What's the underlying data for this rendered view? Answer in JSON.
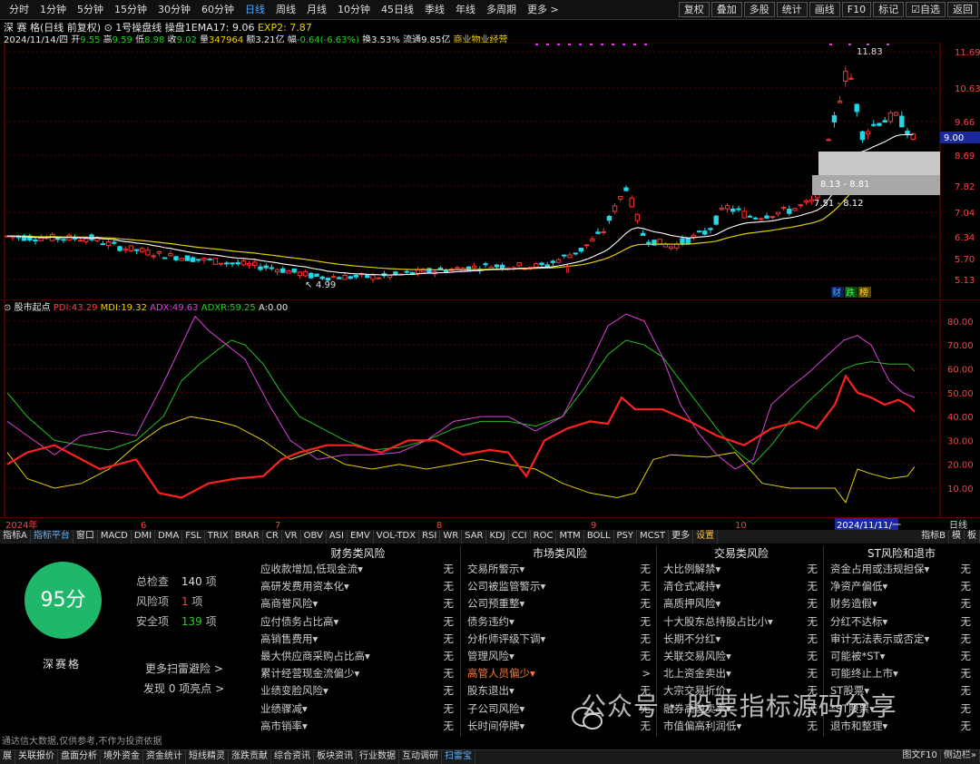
{
  "toolbar": {
    "period_tabs": [
      "分时",
      "1分钟",
      "5分钟",
      "15分钟",
      "30分钟",
      "60分钟",
      "日线",
      "周线",
      "月线",
      "10分钟",
      "45日线",
      "季线",
      "年线",
      "多周期",
      "更多 >"
    ],
    "active_tab": "日线",
    "right_buttons": [
      "复权",
      "叠加",
      "多股",
      "统计",
      "画线",
      "F10",
      "标记",
      "☑自选",
      "返回"
    ]
  },
  "info": {
    "stock_title": "深 赛 格(日线 前复权)",
    "indicator_name": "1号操盘线",
    "ema_label": "操盘1EMA17:",
    "ema_value": "9.06",
    "exp2_label": "EXP2:",
    "exp2_value": "7.87",
    "date": "2024/11/14/四",
    "open_label": "开",
    "open": "9.55",
    "high_label": "高",
    "high": "9.59",
    "low_label": "低",
    "low": "8.98",
    "close_label": "收",
    "close": "9.02",
    "volume_label": "量",
    "volume": "347964",
    "amount_label": "额",
    "amount": "3.21亿",
    "change_label": "幅",
    "change": "-0.64(-6.63%)",
    "turnover_label": "换",
    "turnover": "3.53%",
    "float_label": "流通",
    "float": "9.85亿",
    "sector": "商业物业经营"
  },
  "main_chart": {
    "y_ticks": [
      "11.69",
      "10.63",
      "9.66",
      "8.69",
      "7.82",
      "7.04",
      "6.34",
      "5.70",
      "5.13"
    ],
    "current_price": "9.00",
    "high_mark": "11.83",
    "low_mark": "4.99",
    "zone1_label": "8.13 - 8.81",
    "zone2_label": "7.51 - 8.12",
    "badges": [
      "财",
      "跌",
      "榜"
    ]
  },
  "indicator": {
    "name": "股市起点",
    "pdi_label": "PDI:",
    "pdi": "43.29",
    "mdi_label": "MDI:",
    "mdi": "19.32",
    "adx_label": "ADX:",
    "adx": "49.63",
    "adxr_label": "ADXR:",
    "adxr": "59.25",
    "a_label": "A:",
    "a": "0.00",
    "y_ticks": [
      "80.00",
      "70.00",
      "60.00",
      "50.00",
      "40.00",
      "30.00",
      "20.00",
      "10.00"
    ]
  },
  "date_axis": {
    "labels": [
      "2024年",
      "6",
      "7",
      "8",
      "9",
      "10"
    ],
    "cursor_date": "2024/11/11/一",
    "period": "日线"
  },
  "indicator_tabs": [
    "指标A",
    "指标平台",
    "窗口",
    "MACD",
    "DMI",
    "DMA",
    "FSL",
    "TRIX",
    "BRAR",
    "CR",
    "VR",
    "OBV",
    "ASI",
    "EMV",
    "VOL-TDX",
    "RSI",
    "WR",
    "SAR",
    "KDJ",
    "CCI",
    "ROC",
    "MTM",
    "BOLL",
    "PSY",
    "MCST",
    "更多",
    "设置"
  ],
  "indicator_tabs_right": [
    "指标B",
    "模",
    "板"
  ],
  "risk": {
    "score": "95分",
    "company": "深赛格",
    "total_label": "总检查",
    "total": "140",
    "risk_label": "风险项",
    "risk_count": "1",
    "safe_label": "安全项",
    "safe_count": "139",
    "unit": "项",
    "more": "更多扫雷避险 >",
    "found": "发现 0 项亮点 >",
    "columns": [
      {
        "title": "财务类风险",
        "rows": [
          {
            "name": "应收款增加,低现金流",
            "val": "无"
          },
          {
            "name": "高研发费用资本化",
            "val": "无"
          },
          {
            "name": "高商誉风险",
            "val": "无"
          },
          {
            "name": "应付债务占比高",
            "val": "无"
          },
          {
            "name": "高销售费用",
            "val": "无"
          },
          {
            "name": "最大供应商采购占比高",
            "val": "无"
          },
          {
            "name": "累计经营现金流偏少",
            "val": "无"
          },
          {
            "name": "业绩变脸风险",
            "val": "无"
          },
          {
            "name": "业绩骤减",
            "val": "无"
          },
          {
            "name": "高市销率",
            "val": "无"
          }
        ]
      },
      {
        "title": "市场类风险",
        "rows": [
          {
            "name": "交易所警示",
            "val": "无"
          },
          {
            "name": "公司被监管警示",
            "val": "无"
          },
          {
            "name": "公司预重整",
            "val": "无"
          },
          {
            "name": "债务违约",
            "val": "无"
          },
          {
            "name": "分析师评级下调",
            "val": "无"
          },
          {
            "name": "管理风险",
            "val": "无"
          },
          {
            "name": "高管人员偏少",
            "val": ">",
            "alert": true
          },
          {
            "name": "股东退出",
            "val": "无"
          },
          {
            "name": "子公司风险",
            "val": "无"
          },
          {
            "name": "长时间停牌",
            "val": "无"
          }
        ]
      },
      {
        "title": "交易类风险",
        "rows": [
          {
            "name": "大比例解禁",
            "val": "无"
          },
          {
            "name": "清仓式减持",
            "val": "无"
          },
          {
            "name": "高质押风险",
            "val": "无"
          },
          {
            "name": "十大股东总持股占比小",
            "val": "无"
          },
          {
            "name": "长期不分红",
            "val": "无"
          },
          {
            "name": "关联交易风险",
            "val": "无"
          },
          {
            "name": "北上资金卖出",
            "val": "无"
          },
          {
            "name": "大宗交易折价",
            "val": "无"
          },
          {
            "name": "融券高融卖率",
            "val": "无"
          },
          {
            "name": "市值偏高利润低",
            "val": "无"
          }
        ]
      },
      {
        "title": "ST风险和退市",
        "rows": [
          {
            "name": "资金占用或违规担保",
            "val": "无"
          },
          {
            "name": "净资产偏低",
            "val": "无"
          },
          {
            "name": "财务造假",
            "val": "无"
          },
          {
            "name": "分红不达标",
            "val": "无"
          },
          {
            "name": "审计无法表示或否定",
            "val": "无"
          },
          {
            "name": "可能被*ST",
            "val": "无"
          },
          {
            "name": "可能终止上市",
            "val": "无"
          },
          {
            "name": "ST股票",
            "val": "无"
          },
          {
            "name": "*ST股票",
            "val": "无"
          },
          {
            "name": "退市和整理",
            "val": "无"
          }
        ]
      }
    ],
    "disclaimer": "通达信大数据,仅供参考,不作为投资依据"
  },
  "watermark": "公众号 · 股票指标源码分享",
  "bottom_tabs": [
    "展",
    "关联报价",
    "盘面分析",
    "境外资金",
    "资金统计",
    "短线精灵",
    "涨跌贡献",
    "综合资讯",
    "板块资讯",
    "行业数据",
    "互动调研",
    "扫雷宝"
  ],
  "bottom_active": "扫雷宝",
  "bottom_right": [
    "图文F10",
    "侧边栏»"
  ],
  "colors": {
    "up": "#ff3030",
    "down": "#20d8e8",
    "ema": "#ffffff",
    "exp2": "#e0d000",
    "pdi": "#ff2020",
    "mdi": "#e0d000",
    "adx": "#e040e0",
    "adxr": "#20c020",
    "grid": "#5a0000",
    "score": "#1fb86a"
  }
}
